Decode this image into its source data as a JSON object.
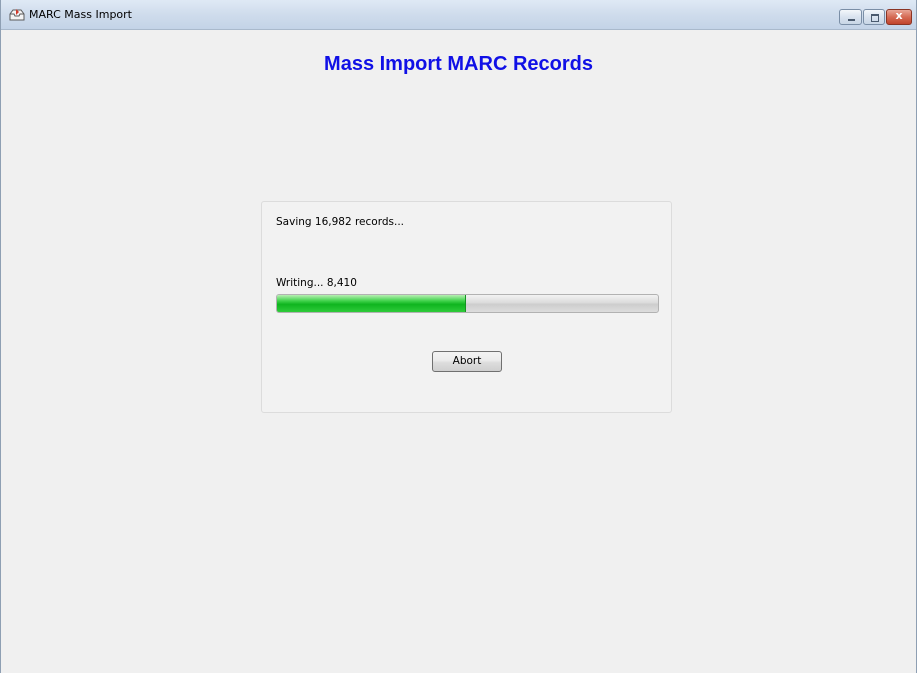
{
  "window": {
    "title": "MARC Mass Import",
    "app_icon": "tray-import-icon",
    "controls": {
      "minimize_icon": "minimize-icon",
      "maximize_icon": "maximize-icon",
      "close_label": "x"
    }
  },
  "main": {
    "heading": "Mass Import MARC Records",
    "heading_color": "#1010e6"
  },
  "progress_panel": {
    "status_text": "Saving 16,982 records...",
    "progress_label": "Writing... 8,410",
    "progress_fraction": 0.495,
    "progress_color": "#0fb51f",
    "abort_label": "Abort"
  }
}
